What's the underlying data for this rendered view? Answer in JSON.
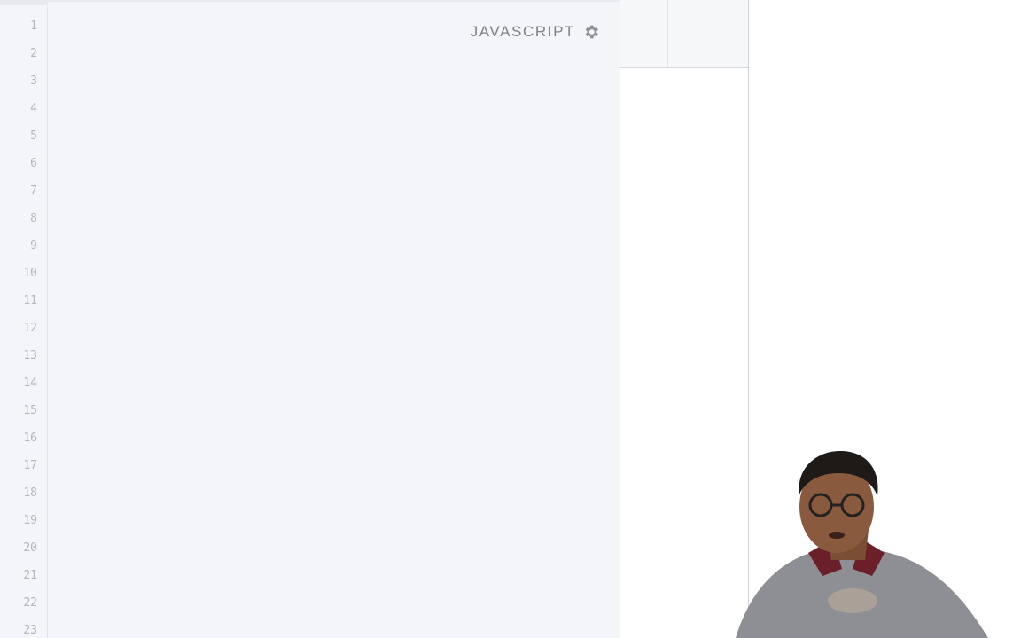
{
  "editor": {
    "language_label": "JAVASCRIPT",
    "settings_icon": "gear-icon",
    "line_numbers": [
      "1",
      "2",
      "3",
      "4",
      "5",
      "6",
      "7",
      "8",
      "9",
      "10",
      "11",
      "12",
      "13",
      "14",
      "15",
      "16",
      "17",
      "18",
      "19",
      "20",
      "21",
      "22",
      "23"
    ]
  },
  "colors": {
    "editor_bg": "#f3f5f8",
    "line_number": "#b0b6bf",
    "label": "#7b8088",
    "gear": "#8b9099"
  }
}
